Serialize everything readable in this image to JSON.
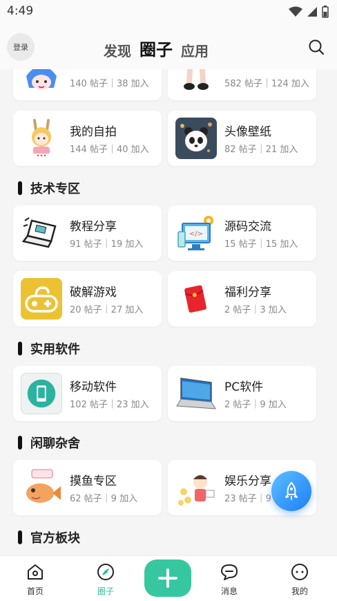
{
  "status_bar": {
    "time": "4:49"
  },
  "header": {
    "login_label": "登录",
    "tabs": [
      {
        "label": "发现"
      },
      {
        "label": "圈子"
      },
      {
        "label": "应用"
      }
    ]
  },
  "circles": [
    {
      "name": "",
      "meta": "140 帖子｜38 加入",
      "icon": "anime-girl-icon"
    },
    {
      "name": "",
      "meta": "582 帖子｜124 加入",
      "icon": "anime-legs-icon"
    },
    {
      "name": "我的自拍",
      "meta": "144 帖子｜40 加入",
      "icon": "selfie-girl-icon"
    },
    {
      "name": "头像壁纸",
      "meta": "82 帖子｜21 加入",
      "icon": "panda-icon"
    }
  ],
  "sections": [
    {
      "title": "技术专区",
      "items": [
        {
          "name": "教程分享",
          "meta": "91 帖子｜19 加入",
          "icon": "laptop-icon"
        },
        {
          "name": "源码交流",
          "meta": "15 帖子｜15 加入",
          "icon": "code-monitor-icon"
        },
        {
          "name": "破解游戏",
          "meta": "20 帖子｜27 加入",
          "icon": "gamepad-icon"
        },
        {
          "name": "福利分享",
          "meta": "2 帖子｜3 加入",
          "icon": "red-envelope-icon"
        }
      ]
    },
    {
      "title": "实用软件",
      "items": [
        {
          "name": "移动软件",
          "meta": "102 帖子｜23 加入",
          "icon": "phone-icon"
        },
        {
          "name": "PC软件",
          "meta": "2 帖子｜9 加入",
          "icon": "pc-laptop-icon"
        }
      ]
    },
    {
      "title": "闲聊杂舍",
      "items": [
        {
          "name": "摸鱼专区",
          "meta": "62 帖子｜9 加入",
          "icon": "fish-icon"
        },
        {
          "name": "娱乐分享",
          "meta": "23 帖子｜9 加入",
          "icon": "entertainment-icon"
        }
      ]
    },
    {
      "title": "官方板块",
      "items": []
    }
  ],
  "bottom_nav": [
    {
      "label": "首页"
    },
    {
      "label": "圈子"
    },
    {
      "label": "消息"
    },
    {
      "label": "我的"
    }
  ],
  "colors": {
    "accent": "#2bbf98",
    "fab": "#36c7a0",
    "rocket": "#1d7dfb"
  }
}
